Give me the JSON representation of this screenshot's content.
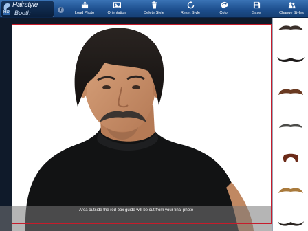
{
  "app": {
    "logo_line1": "Hairstyle",
    "logo_line2": "Booth",
    "logo_badge": "HD"
  },
  "toolbar": {
    "facebook_glyph": "f",
    "buttons": [
      {
        "label": "Load Photo",
        "icon": "photo-upload-icon"
      },
      {
        "label": "Orientation",
        "icon": "orientation-icon"
      },
      {
        "label": "Delete Style",
        "icon": "trash-icon"
      },
      {
        "label": "Reset Style",
        "icon": "reset-icon"
      },
      {
        "label": "Color",
        "icon": "palette-icon"
      },
      {
        "label": "Save",
        "icon": "save-icon"
      },
      {
        "label": "Change Styles",
        "icon": "people-icon"
      }
    ]
  },
  "canvas": {
    "notice": "Area outside the red box guide will be cut from your final photo"
  },
  "style_panel": {
    "items": [
      {
        "name": "mustache-chevron-dark",
        "color": "#3a2f2a"
      },
      {
        "name": "mustache-handlebar-black",
        "color": "#1e1b1a"
      },
      {
        "name": "mustache-walrus-brown",
        "color": "#6a3a22"
      },
      {
        "name": "mustache-pencil-gray",
        "color": "#4b4b48"
      },
      {
        "name": "mustache-horseshoe-red",
        "color": "#6b2a18"
      },
      {
        "name": "mustache-chevron-blonde",
        "color": "#a97a3c"
      },
      {
        "name": "mustache-handlebar-dark",
        "color": "#2a2420"
      }
    ]
  },
  "colors": {
    "toolbar": "#1d4f8e",
    "guide": "#c61c2b",
    "panel": "#ffffff"
  }
}
